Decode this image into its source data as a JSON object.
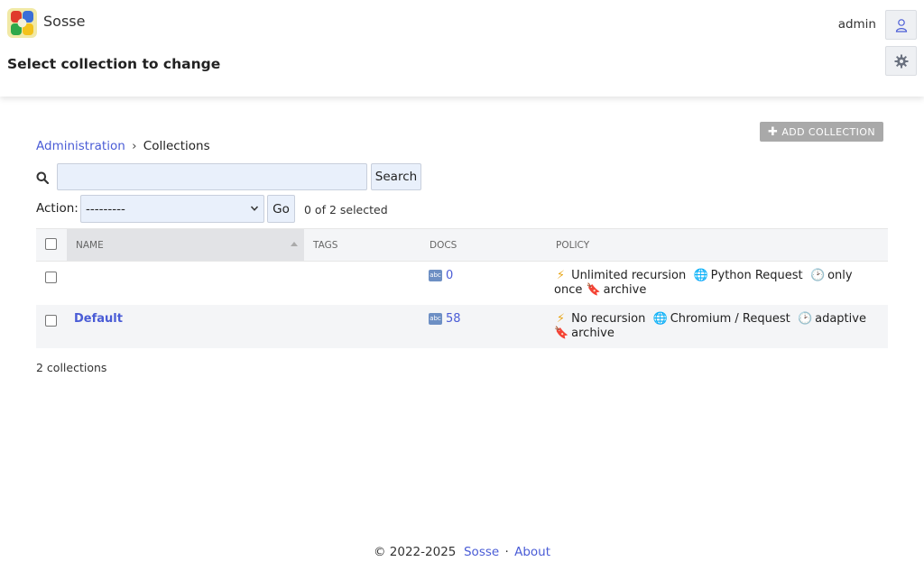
{
  "app": {
    "name": "Sosse"
  },
  "header": {
    "title": "Select collection to change",
    "username": "admin"
  },
  "toolbar": {
    "add_label": "ADD COLLECTION",
    "add_icon": "plus-icon"
  },
  "breadcrumb": {
    "parent": "Administration",
    "separator": "›",
    "current": "Collections"
  },
  "search": {
    "value": "",
    "button_label": "Search"
  },
  "actions": {
    "label": "Action:",
    "selected": "---------",
    "go_label": "Go",
    "selected_count": "0 of 2 selected"
  },
  "table": {
    "columns": {
      "name": "NAME",
      "tags": "TAGS",
      "docs": "DOCS",
      "policy": "POLICY"
    },
    "rows": [
      {
        "name": "",
        "docs": "0",
        "policy": [
          {
            "icon": "⚡",
            "text": "Unlimited recursion"
          },
          {
            "icon": "🌐",
            "text": "Python Request"
          },
          {
            "icon": "🕑",
            "text": "only once"
          },
          {
            "icon": "🔖",
            "text": "archive"
          }
        ]
      },
      {
        "name": "Default",
        "docs": "58",
        "policy": [
          {
            "icon": "⚡",
            "text": "No recursion"
          },
          {
            "icon": "🌐",
            "text": "Chromium / Request"
          },
          {
            "icon": "🕑",
            "text": "adaptive"
          },
          {
            "icon": "🔖",
            "text": "archive"
          }
        ]
      }
    ]
  },
  "total_label": "2 collections",
  "footer": {
    "copyright": "© 2022-2025",
    "link_sosse": "Sosse",
    "separator": "·",
    "link_about": "About"
  }
}
